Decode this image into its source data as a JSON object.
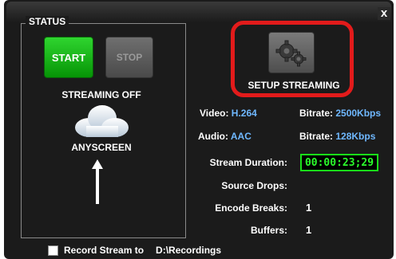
{
  "window": {
    "close_glyph": "x"
  },
  "status": {
    "title": "STATUS",
    "start_label": "START",
    "stop_label": "STOP",
    "state_text": "STREAMING OFF",
    "service_name": "ANYSCREEN"
  },
  "setup": {
    "label": "SETUP STREAMING",
    "icon": "gears-icon"
  },
  "stream_info": {
    "video_label": "Video:",
    "video_value": "H.264",
    "video_bitrate_label": "Bitrate:",
    "video_bitrate_value": "2500Kbps",
    "audio_label": "Audio:",
    "audio_value": "AAC",
    "audio_bitrate_label": "Bitrate:",
    "audio_bitrate_value": "128Kbps"
  },
  "stats": {
    "duration_label": "Stream Duration:",
    "duration_value": "00:00:23;29",
    "drops_label": "Source Drops:",
    "encode_label": "Encode Breaks:",
    "encode_value": "1",
    "buffers_label": "Buffers:",
    "buffers_value": "1"
  },
  "footer": {
    "record_label": "Record Stream to",
    "record_path": "D:\\Recordings",
    "record_checked": false
  },
  "colors": {
    "background": "#1b1b1b",
    "start": "#0fae0f",
    "highlight": "#e21b1b",
    "value_blue": "#6fb8ff",
    "timer_green": "#2bff2b"
  }
}
